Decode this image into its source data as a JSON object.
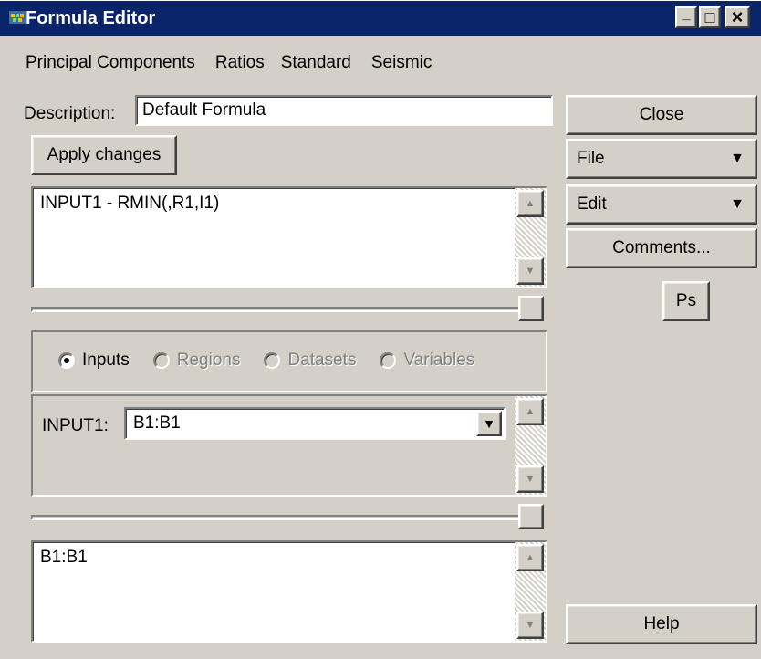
{
  "window": {
    "title": "Formula Editor",
    "controls": {
      "minimize": "_",
      "maximize": "□",
      "close": "×"
    }
  },
  "menu": [
    "Principal Components",
    "Ratios",
    "Standard",
    "Seismic"
  ],
  "description": {
    "label": "Description:",
    "value": "Default Formula"
  },
  "apply_label": "Apply changes",
  "formula_text": "INPUT1 - RMIN(,R1,I1)",
  "radio_options": [
    {
      "label": "Inputs",
      "checked": true,
      "enabled": true
    },
    {
      "label": "Regions",
      "checked": false,
      "enabled": false
    },
    {
      "label": "Datasets",
      "checked": false,
      "enabled": false
    },
    {
      "label": "Variables",
      "checked": false,
      "enabled": false
    }
  ],
  "input_row": {
    "label": "INPUT1:",
    "value": "B1:B1"
  },
  "bottom_text": "B1:B1",
  "right_buttons": {
    "close": "Close",
    "file": "File",
    "edit": "Edit",
    "comments": "Comments...",
    "ps": "Ps",
    "help": "Help"
  },
  "icons": {
    "dropdown": "▼",
    "scroll_up": "▲",
    "scroll_down": "▼"
  },
  "colors": {
    "titlebar": "#0a246a",
    "face": "#d4d0c8",
    "disabled_text": "#808080"
  }
}
